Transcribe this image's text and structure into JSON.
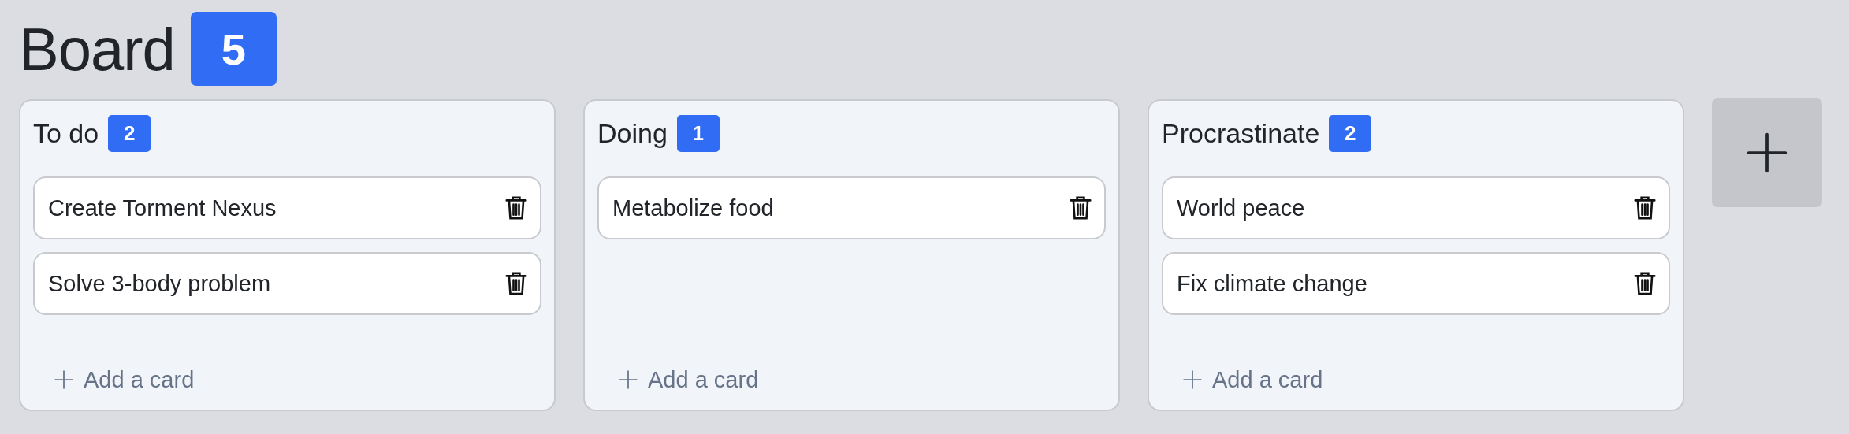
{
  "board": {
    "title": "Board",
    "count": "5"
  },
  "columns": [
    {
      "title": "To do",
      "count": "2",
      "cards": [
        {
          "text": "Create Torment Nexus"
        },
        {
          "text": "Solve 3-body problem"
        }
      ],
      "add_label": "Add a card"
    },
    {
      "title": "Doing",
      "count": "1",
      "cards": [
        {
          "text": "Metabolize food"
        }
      ],
      "add_label": "Add a card"
    },
    {
      "title": "Procrastinate",
      "count": "2",
      "cards": [
        {
          "text": "World peace"
        },
        {
          "text": "Fix climate change"
        }
      ],
      "add_label": "Add a card"
    }
  ]
}
